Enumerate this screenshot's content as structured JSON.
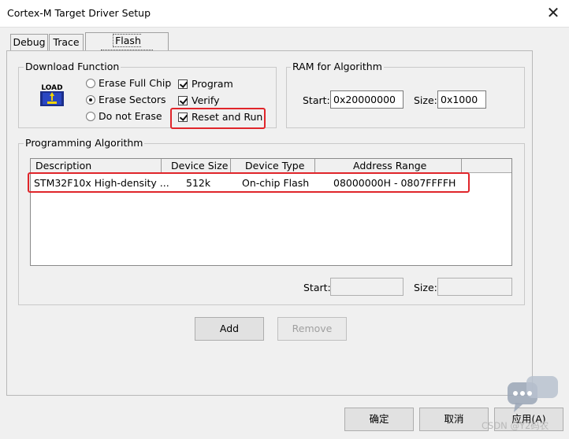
{
  "window": {
    "title": "Cortex-M Target Driver Setup",
    "close_glyph": "✕"
  },
  "tabs": [
    {
      "label": "Debug"
    },
    {
      "label": "Trace"
    },
    {
      "label": "Flash Download",
      "active": true
    }
  ],
  "download_function": {
    "legend": "Download Function",
    "icon": "load-icon",
    "icon_text": "LOAD",
    "erase_options": [
      {
        "label": "Erase Full Chip",
        "selected": false
      },
      {
        "label": "Erase Sectors",
        "selected": true
      },
      {
        "label": "Do not Erase",
        "selected": false
      }
    ],
    "checks": [
      {
        "label": "Program",
        "checked": true
      },
      {
        "label": "Verify",
        "checked": true
      },
      {
        "label": "Reset and Run",
        "checked": true
      }
    ]
  },
  "ram_for_algorithm": {
    "legend": "RAM for Algorithm",
    "start_label": "Start:",
    "start_value": "0x20000000",
    "size_label": "Size:",
    "size_value": "0x1000"
  },
  "programming_algorithm": {
    "legend": "Programming Algorithm",
    "columns": [
      "Description",
      "Device Size",
      "Device Type",
      "Address Range"
    ],
    "rows": [
      {
        "description": "STM32F10x High-density ...",
        "device_size": "512k",
        "device_type": "On-chip Flash",
        "address_range": "08000000H - 0807FFFFH"
      }
    ],
    "start_label": "Start:",
    "start_value": "",
    "size_label": "Size:",
    "size_value": ""
  },
  "buttons": {
    "add": "Add",
    "remove": "Remove",
    "ok": "确定",
    "cancel": "取消",
    "apply": "应用(A)"
  },
  "watermark": {
    "text": "CSDN @Y2码农"
  },
  "colors": {
    "highlight_red": "#e0252a",
    "dialog_bg": "#f0f0f0"
  }
}
